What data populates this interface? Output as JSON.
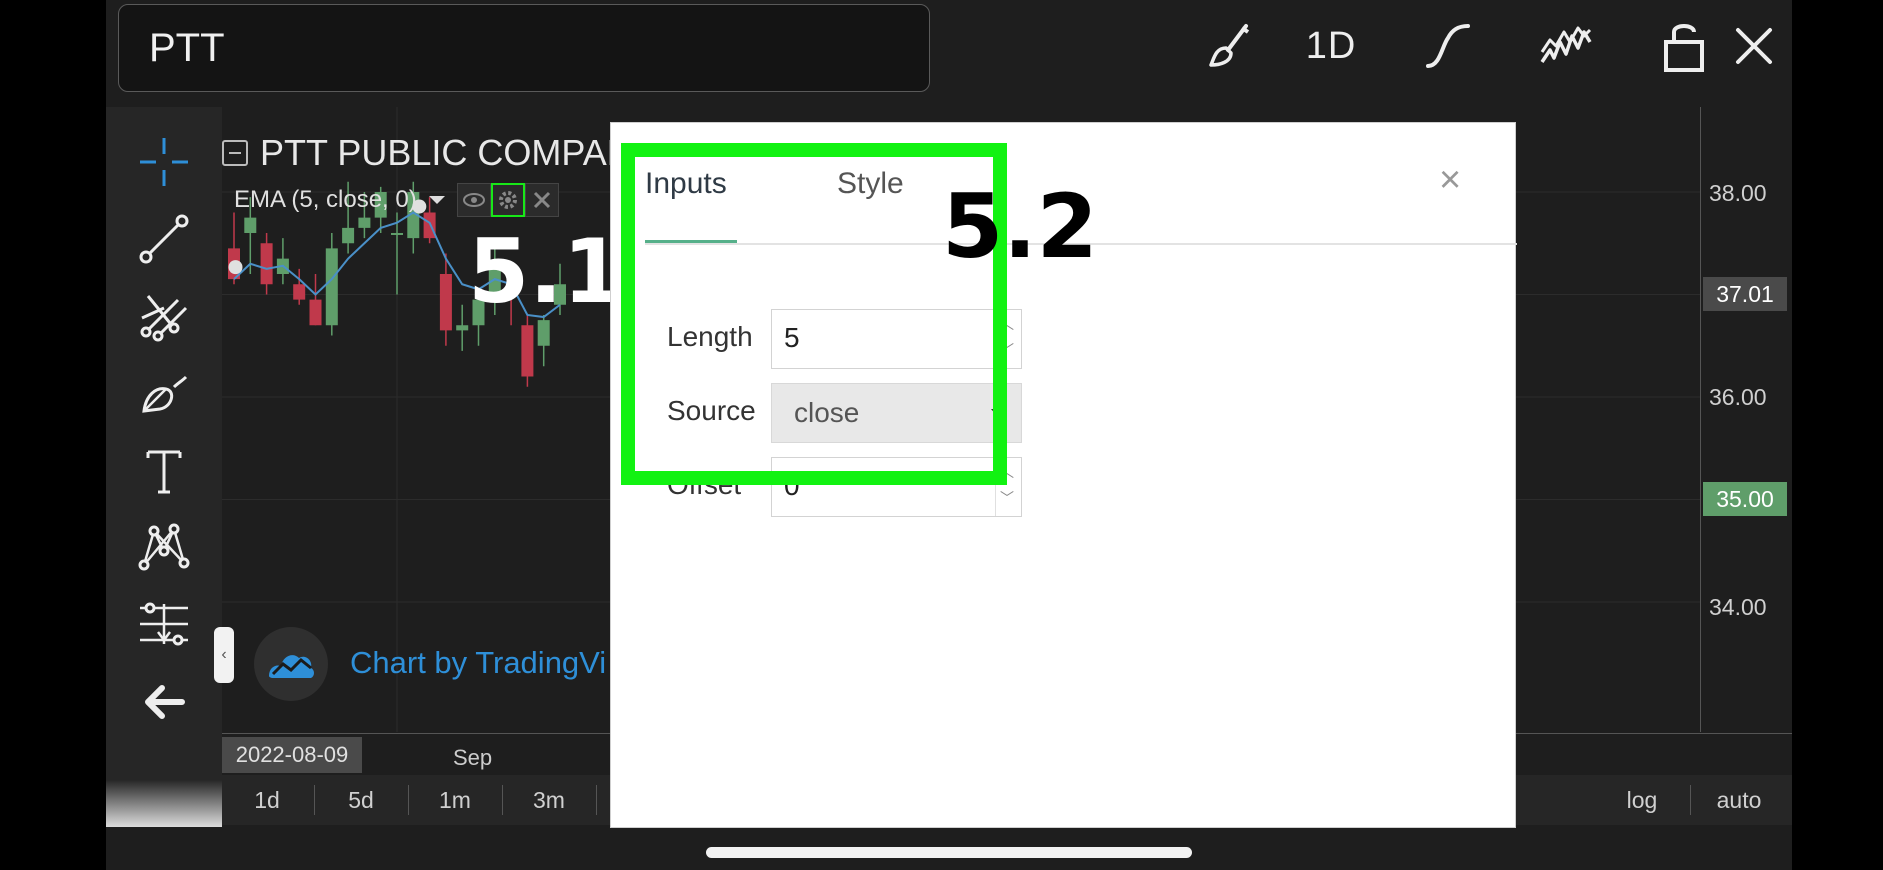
{
  "topbar": {
    "symbol": "PTT",
    "interval": "1D",
    "icons": [
      "brush-icon",
      "curve-icon",
      "indicators-icon",
      "lock-icon",
      "close-icon"
    ]
  },
  "legend": {
    "title": "PTT PUBLIC COMPAN",
    "indicator": "EMA (5, close, 0)"
  },
  "annotations": {
    "step_a": "5.1",
    "step_b": "5.2"
  },
  "dialog": {
    "tabs": [
      {
        "label": "Inputs",
        "active": true
      },
      {
        "label": "Style",
        "active": false
      }
    ],
    "close_glyph": "×",
    "fields": {
      "length": {
        "label": "Length",
        "value": "5"
      },
      "source": {
        "label": "Source",
        "value": "close"
      },
      "offset": {
        "label": "Offset",
        "value": "0"
      }
    }
  },
  "price_scale": {
    "labels": [
      "38.00",
      "36.00",
      "34.00"
    ],
    "current_price": "37.01",
    "crosshair_price": "35.00"
  },
  "time_scale": {
    "date_tag": "2022-08-09",
    "labels": [
      "Sep"
    ]
  },
  "watermark": "Chart by TradingVi",
  "ranges": [
    "1d",
    "5d",
    "1m",
    "3m"
  ],
  "scale_options": [
    "log",
    "auto"
  ],
  "colors": {
    "up": "#5f9e6a",
    "down": "#c0394b",
    "ema": "#4a90c8",
    "highlight": "#12f212",
    "tab_underline": "#56b08a",
    "brand": "#2e8fd8"
  },
  "chart_data": {
    "type": "candlestick",
    "series_name": "EMA (5, close, 0)",
    "ylim": [
      34.0,
      38.5
    ],
    "candles": [
      {
        "o": 37.45,
        "h": 37.8,
        "l": 37.1,
        "c": 37.15
      },
      {
        "o": 37.6,
        "h": 37.95,
        "l": 37.2,
        "c": 37.75
      },
      {
        "o": 37.5,
        "h": 37.6,
        "l": 37.0,
        "c": 37.1
      },
      {
        "o": 37.2,
        "h": 37.55,
        "l": 37.1,
        "c": 37.35
      },
      {
        "o": 37.1,
        "h": 37.25,
        "l": 36.9,
        "c": 36.95
      },
      {
        "o": 36.95,
        "h": 37.2,
        "l": 36.7,
        "c": 36.7
      },
      {
        "o": 36.7,
        "h": 37.6,
        "l": 36.6,
        "c": 37.45
      },
      {
        "o": 37.5,
        "h": 38.1,
        "l": 37.4,
        "c": 37.65
      },
      {
        "o": 37.65,
        "h": 38.0,
        "l": 37.55,
        "c": 37.75
      },
      {
        "o": 37.75,
        "h": 38.05,
        "l": 37.6,
        "c": 38.0
      },
      {
        "o": 37.6,
        "h": 37.8,
        "l": 37.0,
        "c": 37.6
      },
      {
        "o": 37.55,
        "h": 38.1,
        "l": 37.4,
        "c": 38.0
      },
      {
        "o": 37.8,
        "h": 37.95,
        "l": 37.5,
        "c": 37.55
      },
      {
        "o": 37.2,
        "h": 37.4,
        "l": 36.5,
        "c": 36.65
      },
      {
        "o": 36.65,
        "h": 36.9,
        "l": 36.45,
        "c": 36.7
      },
      {
        "o": 36.7,
        "h": 37.0,
        "l": 36.5,
        "c": 36.95
      },
      {
        "o": 36.95,
        "h": 37.5,
        "l": 36.8,
        "c": 37.3
      },
      {
        "o": 37.05,
        "h": 37.2,
        "l": 36.7,
        "c": 37.0
      },
      {
        "o": 36.7,
        "h": 36.8,
        "l": 36.1,
        "c": 36.2
      },
      {
        "o": 36.5,
        "h": 36.8,
        "l": 36.3,
        "c": 36.75
      },
      {
        "o": 36.9,
        "h": 37.3,
        "l": 36.8,
        "c": 37.1
      }
    ],
    "ema": [
      37.15,
      37.3,
      37.25,
      37.28,
      37.15,
      37.0,
      37.15,
      37.35,
      37.5,
      37.65,
      37.7,
      37.8,
      37.7,
      37.35,
      37.1,
      37.05,
      37.15,
      37.1,
      36.8,
      36.78,
      36.9
    ]
  }
}
